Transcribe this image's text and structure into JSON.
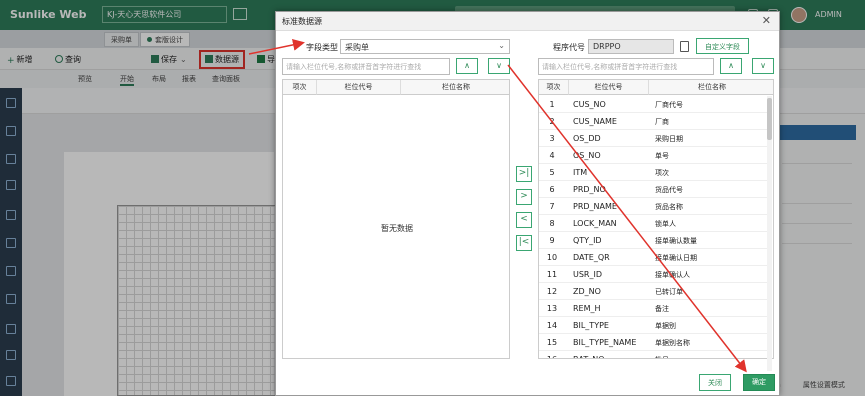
{
  "app": {
    "brand": "Sunlike Web",
    "company": "KJ-天心天思软件公司",
    "user": "ADMIN"
  },
  "tabs": [
    {
      "label": "采购单"
    },
    {
      "label": "套版设计"
    }
  ],
  "toolbar": {
    "new_label": "新增",
    "query_label": "查询",
    "save_label": "保存",
    "datasource_label": "数据源",
    "export_label": "导"
  },
  "ribbon": {
    "preview": "预览",
    "start": "开始",
    "layout": "布局",
    "report": "报表",
    "query_panel": "查询面板"
  },
  "statusbar": {
    "unit": "cm",
    "mode": "属性设置模式"
  },
  "dialog": {
    "title": "标准数据源",
    "field_type_label": "字段类型",
    "field_type_value": "采购单",
    "program_code_label": "程序代号",
    "program_code_value": "DRPPO",
    "custom_field_button": "自定义字段",
    "left_search_placeholder": "请输入栏位代号,名称或拼音首字符进行查找",
    "right_search_placeholder": "请输入栏位代号,名称或拼音首字符进行查找",
    "left_table": {
      "headers": [
        "项次",
        "栏位代号",
        "栏位名称"
      ],
      "empty_text": "暂无数据"
    },
    "right_table": {
      "headers": [
        "项次",
        "栏位代号",
        "栏位名称"
      ],
      "rows": [
        {
          "no": "1",
          "code": "CUS_NO",
          "name": "厂商代号"
        },
        {
          "no": "2",
          "code": "CUS_NAME",
          "name": "厂商"
        },
        {
          "no": "3",
          "code": "OS_DD",
          "name": "采购日期"
        },
        {
          "no": "4",
          "code": "OS_NO",
          "name": "单号"
        },
        {
          "no": "5",
          "code": "ITM",
          "name": "项次"
        },
        {
          "no": "6",
          "code": "PRD_NO",
          "name": "货品代号"
        },
        {
          "no": "7",
          "code": "PRD_NAME",
          "name": "货品名称"
        },
        {
          "no": "8",
          "code": "LOCK_MAN",
          "name": "锁单人"
        },
        {
          "no": "9",
          "code": "QTY_ID",
          "name": "接单确认数量"
        },
        {
          "no": "10",
          "code": "DATE_QR",
          "name": "接单确认日期"
        },
        {
          "no": "11",
          "code": "USR_ID",
          "name": "接单确认人"
        },
        {
          "no": "12",
          "code": "ZD_NO",
          "name": "已转订单"
        },
        {
          "no": "13",
          "code": "REM_H",
          "name": "备注"
        },
        {
          "no": "14",
          "code": "BIL_TYPE",
          "name": "单据别"
        },
        {
          "no": "15",
          "code": "BIL_TYPE_NAME",
          "name": "单据别名称"
        },
        {
          "no": "16",
          "code": "BAT_NO",
          "name": "批号"
        }
      ]
    },
    "move_buttons": {
      "move_all_right": ">|",
      "move_right": ">",
      "move_left": "<",
      "move_all_left": "|<"
    },
    "up_label": "∧",
    "down_label": "∨",
    "close_button": "关闭",
    "confirm_button": "确定"
  },
  "colors": {
    "brand_green": "#2e7d5b",
    "accent_green": "#2e9b63",
    "annotation_red": "#e0332c"
  }
}
